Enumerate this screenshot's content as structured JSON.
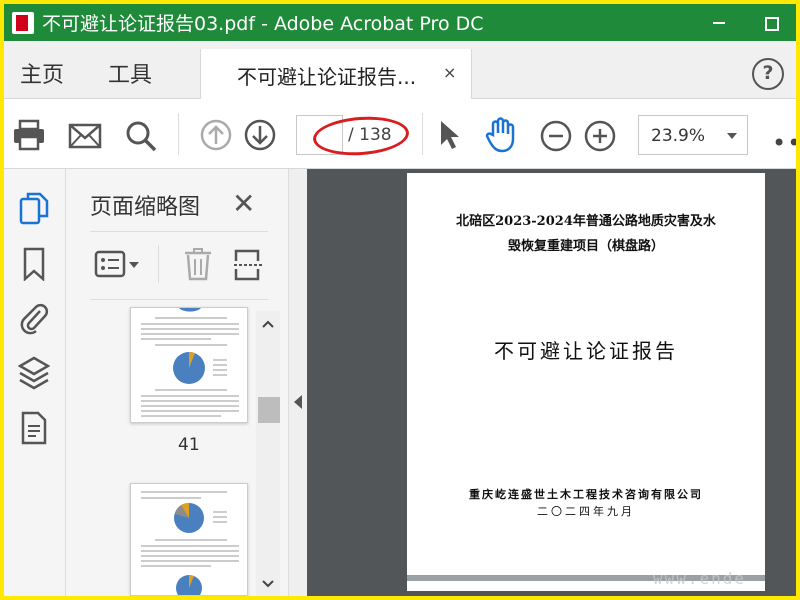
{
  "window": {
    "title": "不可避让论证报告03.pdf - Adobe Acrobat Pro DC",
    "accent": "#1F8A3A"
  },
  "tabs": {
    "home": "主页",
    "tools": "工具",
    "document": "不可避让论证报告...",
    "close_glyph": "×",
    "help_glyph": "?"
  },
  "toolbar": {
    "icons": [
      "print-icon",
      "email-icon",
      "search-icon",
      "prev-page-icon",
      "next-page-icon",
      "select-arrow-icon",
      "hand-tool-icon",
      "zoom-out-icon",
      "zoom-in-icon",
      "more-icon"
    ],
    "page_current": "",
    "page_total": "/ 138",
    "zoom": "23.9%",
    "more": "•••"
  },
  "thumbnails_panel": {
    "title": "页面缩略图",
    "close_glyph": "✕",
    "page_label": "41"
  },
  "document_page": {
    "line1": "北碚区2023-2024年普通公路地质灾害及水",
    "line2": "毁恢复重建项目（棋盘路）",
    "title": "不可避让论证报告",
    "company": "重庆屹连盛世土木工程技术咨询有限公司",
    "date": "二〇二四年九月"
  },
  "watermark": "www.ende"
}
